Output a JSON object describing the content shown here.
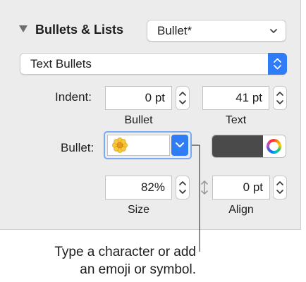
{
  "section": {
    "title": "Bullets & Lists",
    "style_select": "Bullet*",
    "type_select": "Text Bullets"
  },
  "indent": {
    "label": "Indent:",
    "bullet_value": "0 pt",
    "bullet_caption": "Bullet",
    "text_value": "41 pt",
    "text_caption": "Text"
  },
  "bullet": {
    "label": "Bullet:",
    "color_swatch": "#4a4a4a"
  },
  "size": {
    "value": "82%",
    "caption": "Size"
  },
  "align": {
    "value": "0 pt",
    "caption": "Align"
  },
  "callout": {
    "line1": "Type a character or add",
    "line2": "an emoji or symbol."
  },
  "colors": {
    "accent": "#2f7cf6",
    "panel_bg": "#ececec"
  }
}
